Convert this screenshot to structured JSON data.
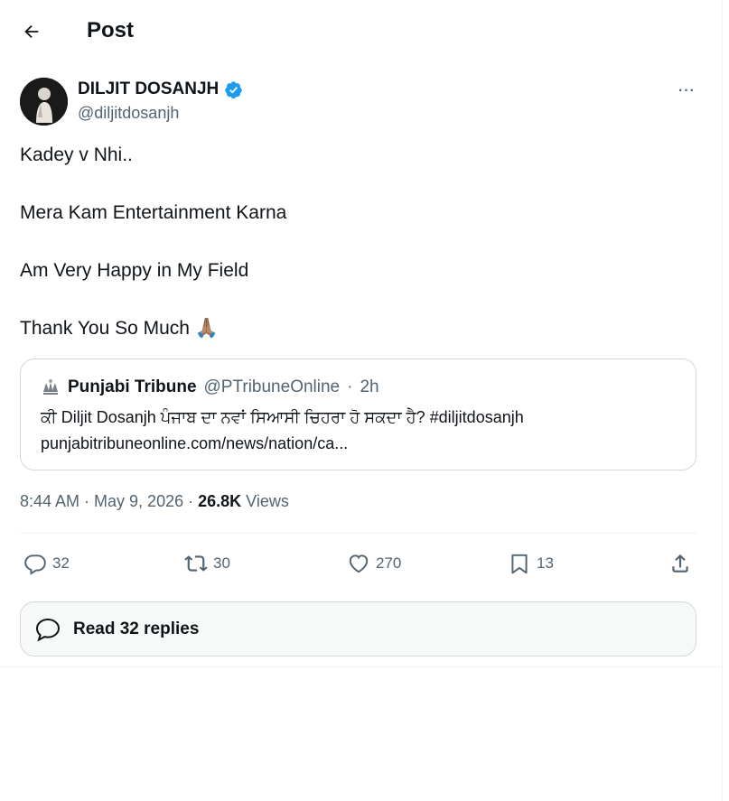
{
  "header": {
    "back_icon": "arrow-left-icon",
    "title": "Post"
  },
  "author": {
    "name": "DILJIT DOSANJH",
    "handle": "@diljitdosanjh",
    "verified_icon": "verified-badge-icon",
    "more_icon": "more-horizontal-icon",
    "more_label": "···"
  },
  "post": {
    "lines": [
      "Kadey v Nhi..",
      "Mera Kam Entertainment Karna",
      "Am Very Happy in My Field",
      "Thank You So Much"
    ],
    "emoji": "🙏🏽"
  },
  "quote": {
    "logo_icon": "punjabi-tribune-logo-icon",
    "name": "Punjabi Tribune",
    "handle": "@PTribuneOnline",
    "separator": "·",
    "time": "2h",
    "text": "ਕੀ Diljit Dosanjh ਪੰਜਾਬ ਦਾ ਨਵਾਂ ਸਿਆਸੀ ਚਿਹਰਾ ਹੋ ਸਕਦਾ ਹੈ?  #diljitdosanjh",
    "link": "punjabitribuneonline.com/news/nation/ca..."
  },
  "meta": {
    "time": "8:44 AM · May 9, 2026 · ",
    "views_count": "26.8K",
    "views_label": " Views"
  },
  "actions": {
    "reply": {
      "icon": "reply-icon",
      "count": "32"
    },
    "repost": {
      "icon": "repost-icon",
      "count": "30"
    },
    "like": {
      "icon": "heart-icon",
      "count": "270"
    },
    "bookmark": {
      "icon": "bookmark-icon",
      "count": "13"
    },
    "share": {
      "icon": "share-icon"
    }
  },
  "read_replies": {
    "icon": "chat-bubble-icon",
    "label": "Read 32 replies"
  },
  "colors": {
    "text": "#0f1419",
    "secondary": "#536471",
    "verified": "#1d9bf0",
    "border": "#cfd9de"
  }
}
